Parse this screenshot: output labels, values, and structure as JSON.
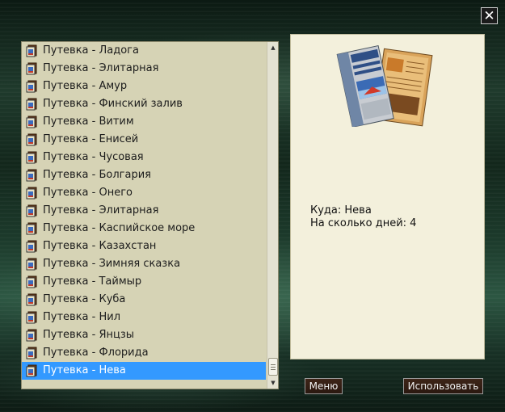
{
  "window": {
    "close_label": "✕"
  },
  "tour_list": {
    "items": [
      "Путевка - Ладога",
      "Путевка - Элитарная",
      "Путевка - Амур",
      "Путевка - Финский залив",
      "Путевка - Витим",
      "Путевка - Енисей",
      "Путевка - Чусовая",
      "Путевка - Болгария",
      "Путевка - Онего",
      "Путевка - Элитарная",
      "Путевка - Каспийское море",
      "Путевка - Казахстан",
      "Путевка - Зимняя сказка",
      "Путевка - Таймыр",
      "Путевка - Куба",
      "Путевка - Нил",
      "Путевка - Янцзы",
      "Путевка - Флорида",
      "Путевка - Нева"
    ],
    "selected_index": 18,
    "item_icon": "tour-voucher-icon",
    "scroll_up_icon": "scroll-up-arrow-icon",
    "scroll_down_icon": "scroll-down-arrow-icon"
  },
  "details": {
    "image_icon": "travel-brochure-icon",
    "destination_line": "Куда: Нева",
    "days_line": "На сколько дней: 4"
  },
  "buttons": {
    "menu_label": "Меню",
    "use_label": "Использовать"
  },
  "colors": {
    "selection": "#3399ff",
    "list_background": "#d6d3b5",
    "detail_background": "#f3f0dc",
    "button_background": "#3e2518"
  }
}
